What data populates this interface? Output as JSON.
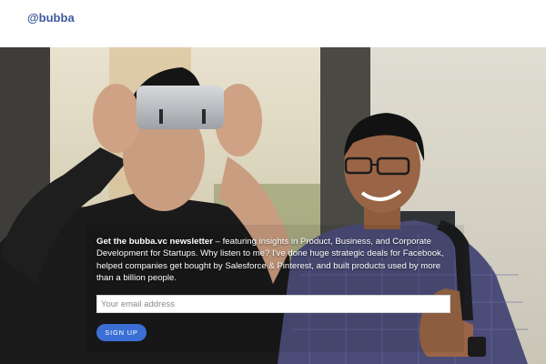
{
  "brand": {
    "title": "@bubba"
  },
  "newsletter": {
    "headline": "Get the bubba.vc newsletter",
    "pitch": " – featuring insights in Product, Business, and Corporate Development for Startups.  Why listen to me? I've done huge strategic deals for Facebook, helped companies get bought by Salesforce & Pinterest, and built products used by more than a billion people.",
    "email_placeholder": "Your email address",
    "email_value": "",
    "signup_label": "SIGN UP"
  },
  "colors": {
    "brand": "#3d5a9e",
    "button": "#3b6fd6",
    "text_on_photo": "#ffffff"
  }
}
